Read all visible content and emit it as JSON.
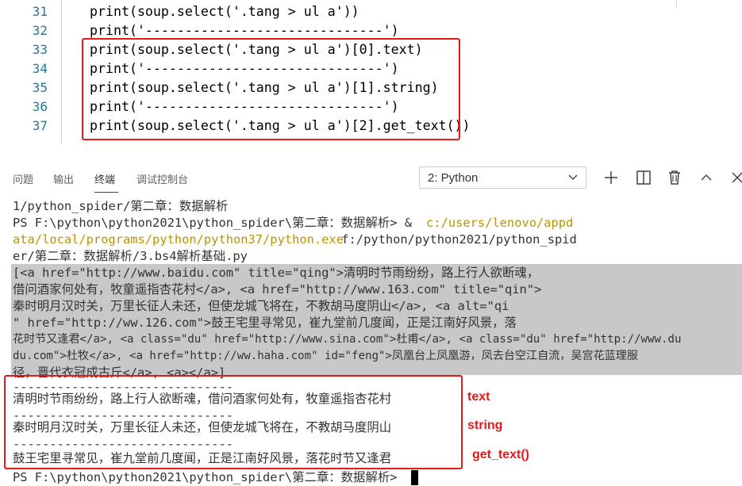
{
  "editor": {
    "lines": [
      {
        "num": "31",
        "code": "print(soup.select('.tang > ul a'))"
      },
      {
        "num": "32",
        "code": "print('------------------------------')"
      },
      {
        "num": "33",
        "code": "print(soup.select('.tang > ul a')[0].text)"
      },
      {
        "num": "34",
        "code": "print('------------------------------')"
      },
      {
        "num": "35",
        "code": "print(soup.select('.tang > ul a')[1].string)"
      },
      {
        "num": "36",
        "code": "print('------------------------------')"
      },
      {
        "num": "37",
        "code": "print(soup.select('.tang > ul a')[2].get_text())"
      }
    ]
  },
  "panel": {
    "tabs": [
      "问题",
      "输出",
      "终端",
      "调试控制台"
    ],
    "active_tab": "终端",
    "terminal_select": "2: Python",
    "icons": [
      "plus-icon",
      "split-icon",
      "trash-icon",
      "chevron-up-icon",
      "close-icon"
    ]
  },
  "terminal": {
    "lines": [
      "1/python_spider/第二章：数据解析",
      "PS F:\\python\\python2021\\python_spider\\第二章：数据解析> & ",
      "c:/users/lenovo/appd",
      "ata/local/programs/python/python37/python.exe",
      " f:/python/python2021/python_spid",
      "er/第二章：数据解析/3.bs4解析基础.py",
      "[<a href=\"http://www.baidu.com\" title=\"qing\">清明时节雨纷纷，路上行人欲断魂，",
      "借问酒家何处有，牧童遥指杏花村</a>, <a href=\"http://www.163.com\" title=\"qin\">",
      "秦时明月汉时关，万里长征人未还，但使龙城飞将在，不教胡马度阴山</a>, <a alt=\"qi",
      "\" href=\"http://ww.126.com\">鼓王宅里寻常见，崔九堂前几度闻，正是江南好风景，落",
      "花时节又逢君</a>, <a class=\"du\" href=\"http://www.sina.com\">杜甫</a>, <a class=\"du\" href=\"http://www.du",
      "du.com\">杜牧</a>, <a href=\"http://ww.haha.com\" id=\"feng\">凤凰台上凤凰游，凤去台空江自流，吴宫花蓝理服",
      "径，晋代衣冠成古斤</a>, <a></a>]",
      "------------------------------",
      "清明时节雨纷纷，路上行人欲断魂，借问酒家何处有，牧童遥指杏花村",
      "------------------------------",
      "秦时明月汉时关，万里长征人未还，但使龙城飞将在，不教胡马度阴山",
      "------------------------------",
      "鼓王宅里寻常见，崔九堂前几度闻，正是江南好风景，落花时节又逢君",
      "PS F:\\python\\python2021\\python_spider\\第二章：数据解析> "
    ]
  },
  "annotations": {
    "text": "text",
    "string": "string",
    "get_text": "get_text()"
  },
  "colors": {
    "highlight_box": "#e21a1a",
    "selection": "#c8c8c8",
    "path_link": "#b89500"
  }
}
